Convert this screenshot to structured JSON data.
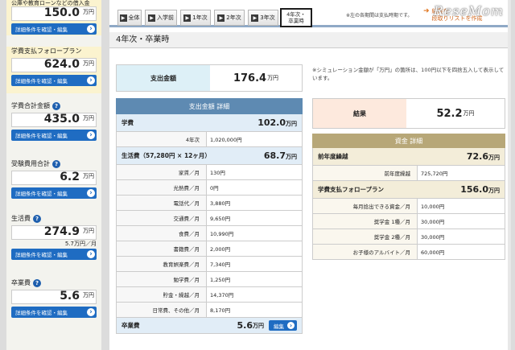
{
  "sidebar": {
    "top_partial": {
      "title": "公庫や教育ローンなどの借入金",
      "value": "150.0",
      "unit": "万円",
      "button": "詳細条件を確認・編集"
    },
    "items": [
      {
        "title": "学費支払フォロープラン",
        "value": "624.0",
        "unit": "万円",
        "button": "詳細条件を確認・編集",
        "sub": ""
      },
      {
        "title": "学費合計金額",
        "value": "435.0",
        "unit": "万円",
        "button": "詳細条件を確認・編集",
        "sub": ""
      },
      {
        "title": "受験費用合計",
        "value": "6.2",
        "unit": "万円",
        "button": "詳細条件を確認・編集",
        "sub": ""
      },
      {
        "title": "生活費",
        "value": "274.9",
        "unit": "万円",
        "button": "詳細条件を確認・編集",
        "sub": "5.7万円／月"
      },
      {
        "title": "卒業費",
        "value": "5.6",
        "unit": "万円",
        "button": "詳細条件を確認・編集",
        "sub": ""
      }
    ]
  },
  "tabs": [
    {
      "label": "全体"
    },
    {
      "label": "入学前"
    },
    {
      "label": "1年次"
    },
    {
      "label": "2年次"
    },
    {
      "label": "3年次"
    },
    {
      "label_line1": "4年次・",
      "label_line2": "卒業時"
    }
  ],
  "tab_note": "※左の各期間は支払時期です。",
  "tab_link": {
    "line1": "結果を",
    "line2": "段取りリストを作成"
  },
  "section_title": "4年次・卒業時",
  "payment": {
    "total_label": "支出金額",
    "total_value": "176.4",
    "total_unit": "万円",
    "detail_header": "支出金額 詳細",
    "groups": [
      {
        "label": "学費",
        "value": "102.0",
        "unit": "万円",
        "rows": [
          {
            "label": "4年次",
            "value": "1,020,000円"
          }
        ]
      },
      {
        "label": "生活費（57,280円 × 12ヶ月）",
        "value": "68.7",
        "unit": "万円",
        "rows": [
          {
            "label": "家賃／月",
            "value": "130円"
          },
          {
            "label": "光熱費／月",
            "value": "0円"
          },
          {
            "label": "電話代／月",
            "value": "3,880円"
          },
          {
            "label": "交通費／月",
            "value": "9,650円"
          },
          {
            "label": "食費／月",
            "value": "10,990円"
          },
          {
            "label": "書籍費／月",
            "value": "2,000円"
          },
          {
            "label": "教育娯楽費／月",
            "value": "7,340円"
          },
          {
            "label": "勉学費／月",
            "value": "1,250円"
          },
          {
            "label": "貯金・繰越／月",
            "value": "14,370円"
          },
          {
            "label": "日常費、その他／月",
            "value": "8,170円"
          }
        ]
      }
    ],
    "graduation": {
      "label": "卒業費",
      "value": "5.6",
      "unit": "万円",
      "button": "編集"
    }
  },
  "sim_note": "※シミュレーション金額が「万円」の箇所は、100円以下を四捨五入して表示しています。",
  "result": {
    "label": "結果",
    "value": "52.2",
    "unit": "万円"
  },
  "fund": {
    "header": "資金 詳細",
    "groups": [
      {
        "label": "前年度繰越",
        "value": "72.6",
        "unit": "万円",
        "rows": [
          {
            "label": "前年度繰越",
            "value": "725,720円"
          }
        ]
      },
      {
        "label": "学費支払フォロープラン",
        "value": "156.0",
        "unit": "万円",
        "rows": [
          {
            "label": "毎月捻出できる資金／月",
            "value": "10,000円"
          },
          {
            "label": "奨学金 1種／月",
            "value": "30,000円"
          },
          {
            "label": "奨学金 2種／月",
            "value": "30,000円"
          },
          {
            "label": "お子様のアルバイト／月",
            "value": "60,000円"
          }
        ]
      }
    ]
  },
  "watermark": "ReseMom"
}
